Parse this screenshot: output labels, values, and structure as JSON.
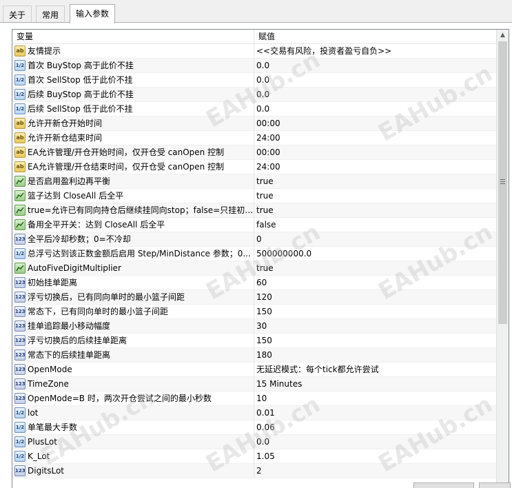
{
  "tabs": [
    {
      "label": "关于"
    },
    {
      "label": "常用"
    },
    {
      "label": "输入参数"
    }
  ],
  "table": {
    "col_variable": "变量",
    "col_value": "赋值",
    "rows": [
      {
        "icon": "ab",
        "name": "友情提示",
        "value": "<<交易有风险，投资者盈亏自负>>"
      },
      {
        "icon": "va",
        "name": "首次 BuyStop 高于此价不挂",
        "value": "0.0"
      },
      {
        "icon": "va",
        "name": "首次 SellStop 低于此价不挂",
        "value": "0.0"
      },
      {
        "icon": "va",
        "name": "后续 BuyStop 高于此价不挂",
        "value": "0.0"
      },
      {
        "icon": "va",
        "name": "后续 SellStop 低于此价不挂",
        "value": "0.0"
      },
      {
        "icon": "ab",
        "name": "允许开新仓开始时间",
        "value": "00:00"
      },
      {
        "icon": "ab",
        "name": "允许开新仓结束时间",
        "value": "24:00"
      },
      {
        "icon": "ab",
        "name": "EA允许管理/开仓开始时间，仅开仓受 canOpen 控制",
        "value": "00:00"
      },
      {
        "icon": "ab",
        "name": "EA允许管理/开仓结束时间，仅开仓受 canOpen 控制",
        "value": "24:00"
      },
      {
        "icon": "bool",
        "name": "是否启用盈利边再平衡",
        "value": "true"
      },
      {
        "icon": "bool",
        "name": "篮子达到 CloseAll 后全平",
        "value": "true"
      },
      {
        "icon": "bool",
        "name": "true=允许已有同向持仓后继续挂同向stop；false=只挂初?...",
        "value": "true"
      },
      {
        "icon": "bool",
        "name": "备用全平开关：达到 CloseAll 后全平",
        "value": "false"
      },
      {
        "icon": "num",
        "name": "全平后冷却秒数；0=不冷却",
        "value": "0"
      },
      {
        "icon": "va",
        "name": "总浮亏达到该正数金额后启用 Step/MinDistance 参数；0...",
        "value": "500000000.0"
      },
      {
        "icon": "bool",
        "name": "AutoFiveDigitMultiplier",
        "value": "true"
      },
      {
        "icon": "num",
        "name": "初始挂单距离",
        "value": "60"
      },
      {
        "icon": "num",
        "name": "浮亏切换后，已有同向单时的最小篮子间距",
        "value": "120"
      },
      {
        "icon": "num",
        "name": "常态下，已有同向单时的最小篮子间距",
        "value": "150"
      },
      {
        "icon": "num",
        "name": "挂单追踪最小移动幅度",
        "value": "30"
      },
      {
        "icon": "num",
        "name": "浮亏切换后的后续挂单距离",
        "value": "150"
      },
      {
        "icon": "num",
        "name": "常态下的后续挂单距离",
        "value": "180"
      },
      {
        "icon": "num",
        "name": "OpenMode",
        "value": "无延迟模式：每个tick都允许尝试"
      },
      {
        "icon": "num",
        "name": "TimeZone",
        "value": "15 Minutes"
      },
      {
        "icon": "num",
        "name": "OpenMode=B 时，两次开仓尝试之间的最小秒数",
        "value": "10"
      },
      {
        "icon": "va",
        "name": "lot",
        "value": "0.01"
      },
      {
        "icon": "va",
        "name": "单笔最大手数",
        "value": "0.06"
      },
      {
        "icon": "va",
        "name": "PlusLot",
        "value": "0.0"
      },
      {
        "icon": "va",
        "name": "K_Lot",
        "value": "1.05"
      },
      {
        "icon": "num",
        "name": "DigitsLot",
        "value": "2"
      }
    ]
  },
  "icon_labels": {
    "ab": "ab",
    "va": "1/2",
    "bool": "",
    "num": "123"
  },
  "watermark": "EAHub.cn"
}
